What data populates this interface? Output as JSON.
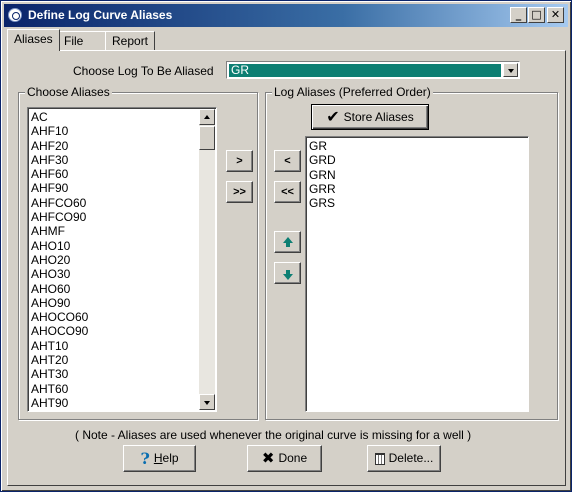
{
  "window": {
    "title": "Define Log Curve Aliases",
    "min_glyph": "_",
    "max_glyph": "□",
    "close_glyph": "✕"
  },
  "tabs": [
    {
      "label": "Aliases",
      "active": true
    },
    {
      "label": "File",
      "active": false
    },
    {
      "label": "Report",
      "active": false
    }
  ],
  "log_select": {
    "label": "Choose Log To Be Aliased",
    "value": "GR"
  },
  "choose_aliases": {
    "title": "Choose Aliases",
    "items": [
      "AC",
      "AHF10",
      "AHF20",
      "AHF30",
      "AHF60",
      "AHF90",
      "AHFCO60",
      "AHFCO90",
      "AHMF",
      "AHO10",
      "AHO20",
      "AHO30",
      "AHO60",
      "AHO90",
      "AHOCO60",
      "AHOCO90",
      "AHT10",
      "AHT20",
      "AHT30",
      "AHT60",
      "AHT90"
    ]
  },
  "transfer_buttons": {
    "add": ">",
    "add_all": ">>",
    "remove": "<",
    "remove_all": "<<"
  },
  "log_aliases": {
    "title": "Log Aliases (Preferred Order)",
    "store_label": "Store Aliases",
    "items": [
      "GR",
      "GRD",
      "GRN",
      "GRR",
      "GRS"
    ]
  },
  "note": "( Note - Aliases are used whenever the original curve is missing for a well )",
  "footer": {
    "help_label_u": "H",
    "help_label_rest": "elp",
    "done_label": "Done",
    "delete_label": "Delete..."
  },
  "icons": {
    "help": "question-mark",
    "done": "x-mark",
    "delete": "trash-can",
    "store": "check-mark"
  },
  "colors": {
    "title_bar": "#0a246a",
    "selection": "#0d7f73",
    "arrow": "#0d7f73"
  }
}
